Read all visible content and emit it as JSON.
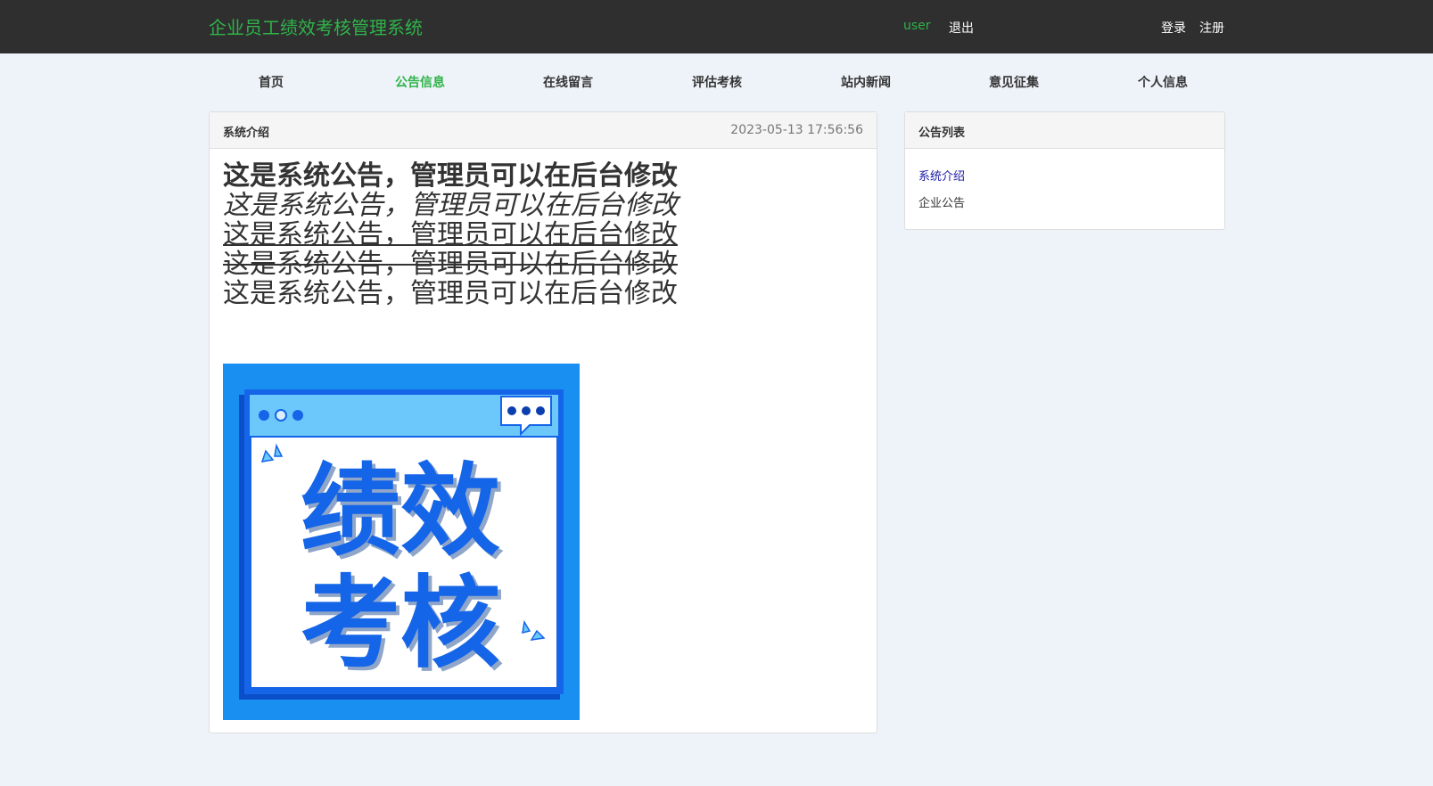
{
  "header": {
    "brand": "企业员工绩效考核管理系统",
    "username": "user",
    "logout": "退出",
    "login": "登录",
    "register": "注册"
  },
  "nav": {
    "items": [
      {
        "label": "首页"
      },
      {
        "label": "公告信息",
        "active": true
      },
      {
        "label": "在线留言"
      },
      {
        "label": "评估考核"
      },
      {
        "label": "站内新闻"
      },
      {
        "label": "意见征集"
      },
      {
        "label": "个人信息"
      }
    ]
  },
  "notice": {
    "title": "系统介绍",
    "time": "2023-05-13 17:56:56",
    "lines": [
      "这是系统公告，管理员可以在后台修改",
      "这是系统公告，管理员可以在后台修改",
      "这是系统公告，管理员可以在后台修改",
      "这是系统公告，管理员可以在后台修改",
      "这是系统公告，管理员可以在后台修改"
    ],
    "banner": {
      "line1": "绩效",
      "line2": "考核"
    }
  },
  "sidebar": {
    "title": "公告列表",
    "items": [
      {
        "label": "系统介绍"
      },
      {
        "label": "企业公告"
      }
    ]
  },
  "colors": {
    "accent": "#2fb34a",
    "topbar": "#2f2f2f",
    "banner_blue": "#1a8ff2"
  }
}
